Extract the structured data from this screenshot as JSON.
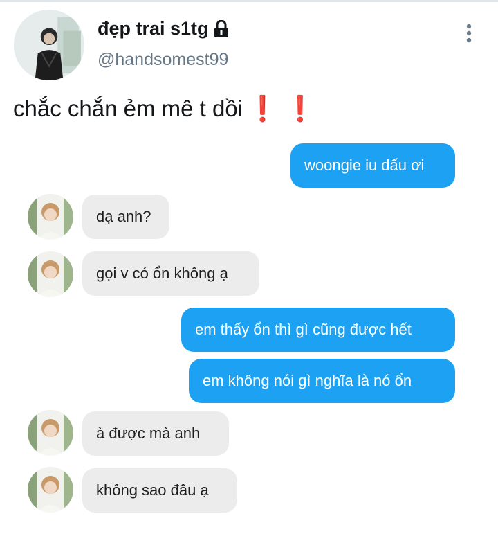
{
  "user": {
    "display_name": "đẹp trai s1tg",
    "handle": "@handsomest99",
    "avatar_icon": "profile-photo",
    "locked_icon": "lock-icon"
  },
  "tweet": {
    "text": "chắc chắn ẻm mê t dồi",
    "emoji": "❗ ❗"
  },
  "messages": [
    {
      "side": "sent",
      "text": "woongie iu dấu ơi"
    },
    {
      "side": "received",
      "text": "dạ anh?"
    },
    {
      "side": "received",
      "text": "gọi v có ổn không ạ"
    },
    {
      "side": "sent",
      "text": "em thấy ổn thì gì cũng được hết"
    },
    {
      "side": "sent",
      "text": "em không nói gì nghĩa là nó ổn"
    },
    {
      "side": "received",
      "text": "à được mà anh"
    },
    {
      "side": "received",
      "text": "không sao đâu ạ"
    }
  ],
  "colors": {
    "sent_bubble": "#1da1f2",
    "received_bubble": "#ececec",
    "handle": "#657786",
    "exclamation": "#e0262b"
  }
}
